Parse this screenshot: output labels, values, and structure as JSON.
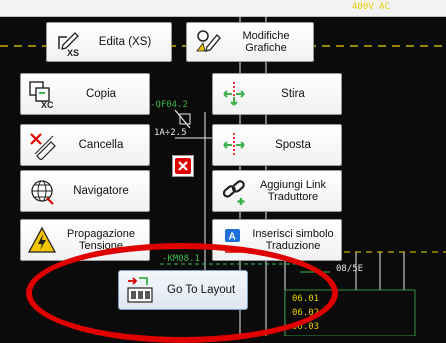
{
  "topbar": {
    "label": "400V AC"
  },
  "menu": {
    "edita_xs": "Edita (XS)",
    "modifiche_grafiche": "Modifiche Grafiche",
    "copia": "Copia",
    "stira": "Stira",
    "cancella": "Cancella",
    "sposta": "Sposta",
    "navigatore": "Navigatore",
    "aggiungi_link": "Aggiungi Link Traduttore",
    "propagazione": "Propagazione Tensione",
    "inserisci_simbolo": "Inserisci simbolo Traduzione",
    "go_to_layout": "Go To Layout"
  },
  "icons": {
    "edita_xs_sub": "XS",
    "copia_sub": "XC"
  },
  "cad_labels": {
    "qf_label": "-QF04.2",
    "range": "1A÷2.5",
    "km_label": "-KM08.1",
    "right_tag": "08/5E",
    "row1": "06.01",
    "row2": "06.02",
    "row3": "06.03"
  },
  "colors": {
    "cad_bg": "#0b0b0b",
    "accent_green": "#3cb44b",
    "accent_red": "#e00000",
    "wire_yellow": "#e6d000",
    "wire_white": "#e8e8e8"
  }
}
